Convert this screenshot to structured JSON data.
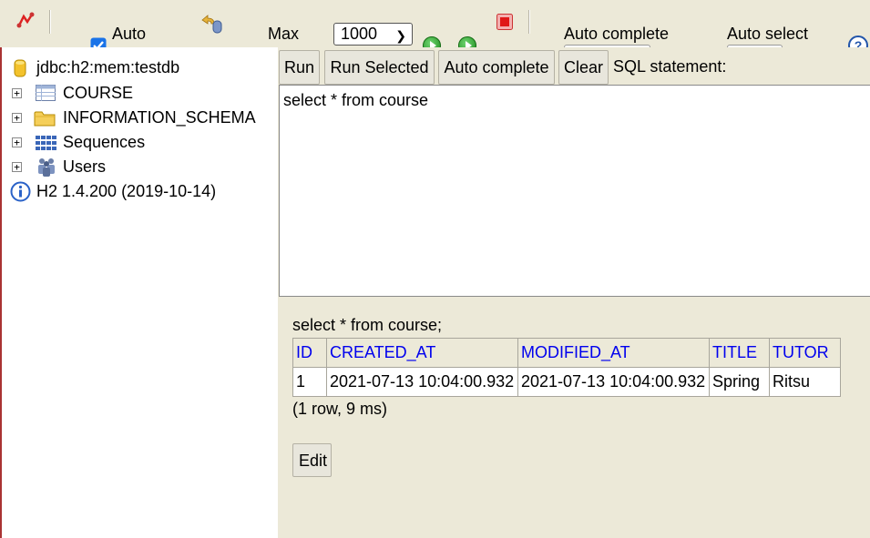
{
  "toolbar": {
    "auto_commit_label": "Auto",
    "auto_commit_checked": true,
    "max_rows_label": "Max",
    "max_rows_value": "1000",
    "auto_complete_label": "Auto complete",
    "auto_select_label": "Auto select"
  },
  "tree": {
    "connection": "jdbc:h2:mem:testdb",
    "items": [
      {
        "label": "COURSE",
        "icon": "table-icon"
      },
      {
        "label": "INFORMATION_SCHEMA",
        "icon": "folder-icon"
      },
      {
        "label": "Sequences",
        "icon": "sequences-icon"
      },
      {
        "label": "Users",
        "icon": "users-icon"
      }
    ],
    "version": "H2 1.4.200 (2019-10-14)"
  },
  "buttons": {
    "run": "Run",
    "run_selected": "Run Selected",
    "auto_complete": "Auto complete",
    "clear": "Clear"
  },
  "sql_label": "SQL statement:",
  "sql_text": "select * from course",
  "result": {
    "echo": "select * from course;",
    "columns": [
      "ID",
      "CREATED_AT",
      "MODIFIED_AT",
      "TITLE",
      "TUTOR"
    ],
    "rows": [
      [
        "1",
        "2021-07-13 10:04:00.932",
        "2021-07-13 10:04:00.932",
        "Spring",
        "Ritsu"
      ]
    ],
    "summary": "(1 row, 9 ms)",
    "edit_label": "Edit"
  },
  "colors": {
    "panel_bg": "#ece9d8",
    "header_link": "#0000ee",
    "tree_border": "#aa3333"
  }
}
